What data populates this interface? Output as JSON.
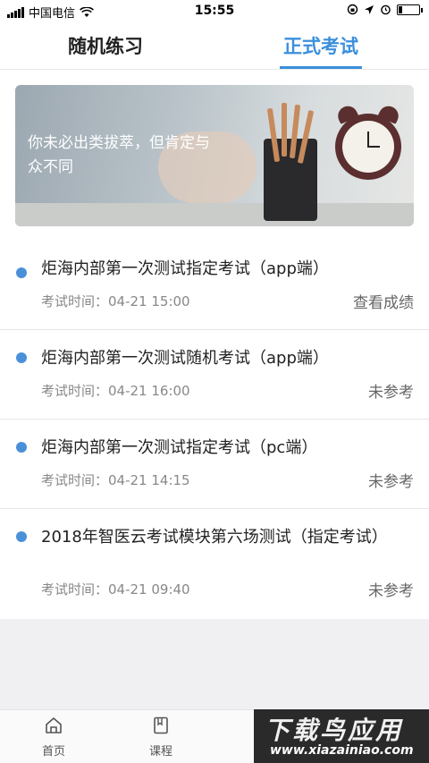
{
  "status_bar": {
    "carrier": "中国电信",
    "time": "15:55",
    "battery_level": 0.2
  },
  "tabs": [
    {
      "label": "随机练习",
      "active": false
    },
    {
      "label": "正式考试",
      "active": true
    }
  ],
  "banner": {
    "text": "你未必出类拔萃，但肯定与众不同"
  },
  "exams": [
    {
      "title": "炬海内部第一次测试指定考试（app端）",
      "time_label": "考试时间：",
      "time": "04-21 15:00",
      "status": "查看成绩"
    },
    {
      "title": "炬海内部第一次测试随机考试（app端）",
      "time_label": "考试时间：",
      "time": "04-21 16:00",
      "status": "未参考"
    },
    {
      "title": "炬海内部第一次测试指定考试（pc端）",
      "time_label": "考试时间：",
      "time": "04-21 14:15",
      "status": "未参考"
    },
    {
      "title": "2018年智医云考试模块第六场测试（指定考试）",
      "time_label": "考试时间：",
      "time": "04-21 09:40",
      "status": "未参考"
    }
  ],
  "bottom_nav": [
    {
      "label": "首页",
      "icon": "home-icon"
    },
    {
      "label": "课程",
      "icon": "book-icon"
    }
  ],
  "watermark": {
    "title": "下载鸟应用",
    "url": "www.xiazainiao.com"
  },
  "colors": {
    "accent": "#3b8fdc",
    "dot": "#4a90d9"
  }
}
